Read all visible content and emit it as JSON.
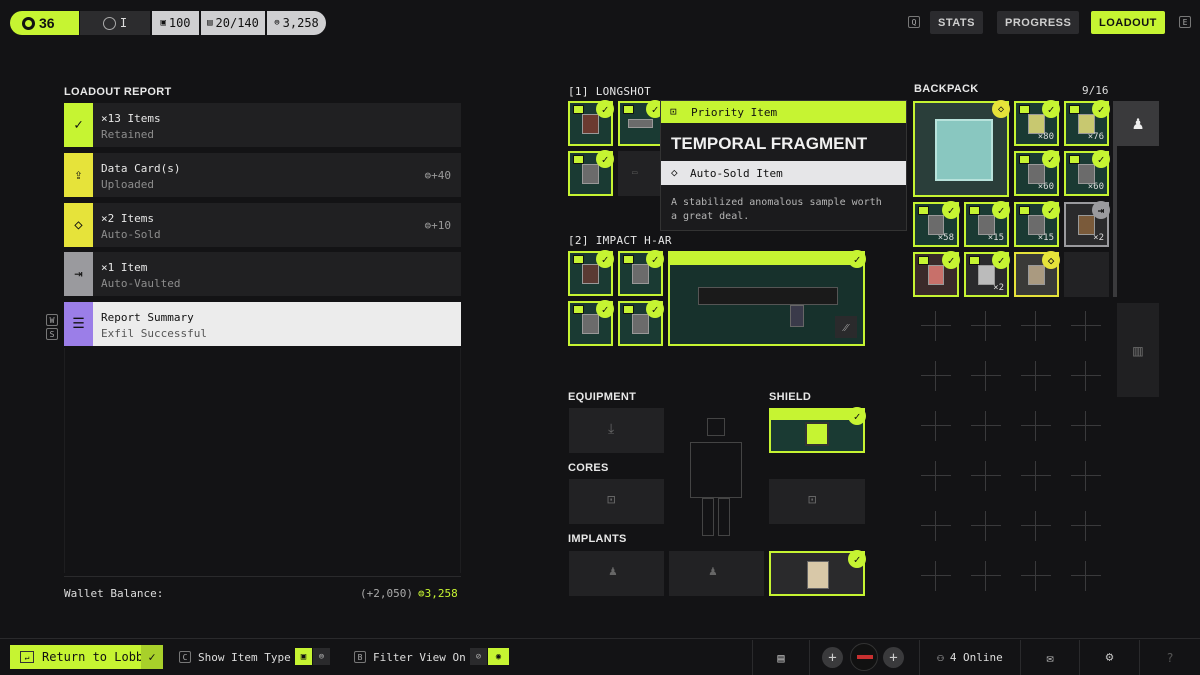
{
  "top": {
    "level": "36",
    "rank": "I",
    "stat1": "100",
    "stat2": "20/140",
    "stat3": "3,258",
    "key_left": "Q",
    "key_right": "E",
    "tabs": [
      "STATS",
      "PROGRESS",
      "LOADOUT"
    ]
  },
  "report": {
    "title": "LOADOUT REPORT",
    "rows": [
      {
        "t1": "×13 Items",
        "t2": "Retained",
        "val": ""
      },
      {
        "t1": "Data Card(s)",
        "t2": "Uploaded",
        "val": "+40"
      },
      {
        "t1": "×2 Items",
        "t2": "Auto-Sold",
        "val": "+10"
      },
      {
        "t1": "×1 Item",
        "t2": "Auto-Vaulted",
        "val": ""
      },
      {
        "t1": "Report Summary",
        "t2": "Exfil Successful",
        "val": ""
      }
    ],
    "keys": [
      "W",
      "S"
    ],
    "wallet_label": "Wallet Balance:",
    "wallet_delta": "(+2,050)",
    "wallet_total": "3,258"
  },
  "weapons": {
    "w1": "[1] LONGSHOT",
    "w2": "[2] IMPACT H-AR"
  },
  "tooltip": {
    "priority": "Priority Item",
    "name": "TEMPORAL FRAGMENT",
    "status": "Auto-Sold Item",
    "desc": "A stabilized anomalous sample worth a great deal."
  },
  "sections": {
    "equipment": "EQUIPMENT",
    "shield": "SHIELD",
    "cores": "CORES",
    "implants": "IMPLANTS",
    "backpack": "BACKPACK",
    "backpack_count": "9/16"
  },
  "backpack_counts": [
    "×80",
    "×76",
    "×60",
    "×60",
    "×58",
    "×15",
    "×15",
    "×2",
    "×2"
  ],
  "bottom": {
    "return": "Return to Lobby",
    "key_c": "C",
    "show_type": "Show Item Type",
    "key_b": "B",
    "filter": "Filter View On",
    "online": "4 Online"
  },
  "colors": {
    "accent": "#c6f432",
    "purple": "#9b7ee8",
    "gray": "#9a9a9e",
    "yellow": "#e6e33a"
  }
}
